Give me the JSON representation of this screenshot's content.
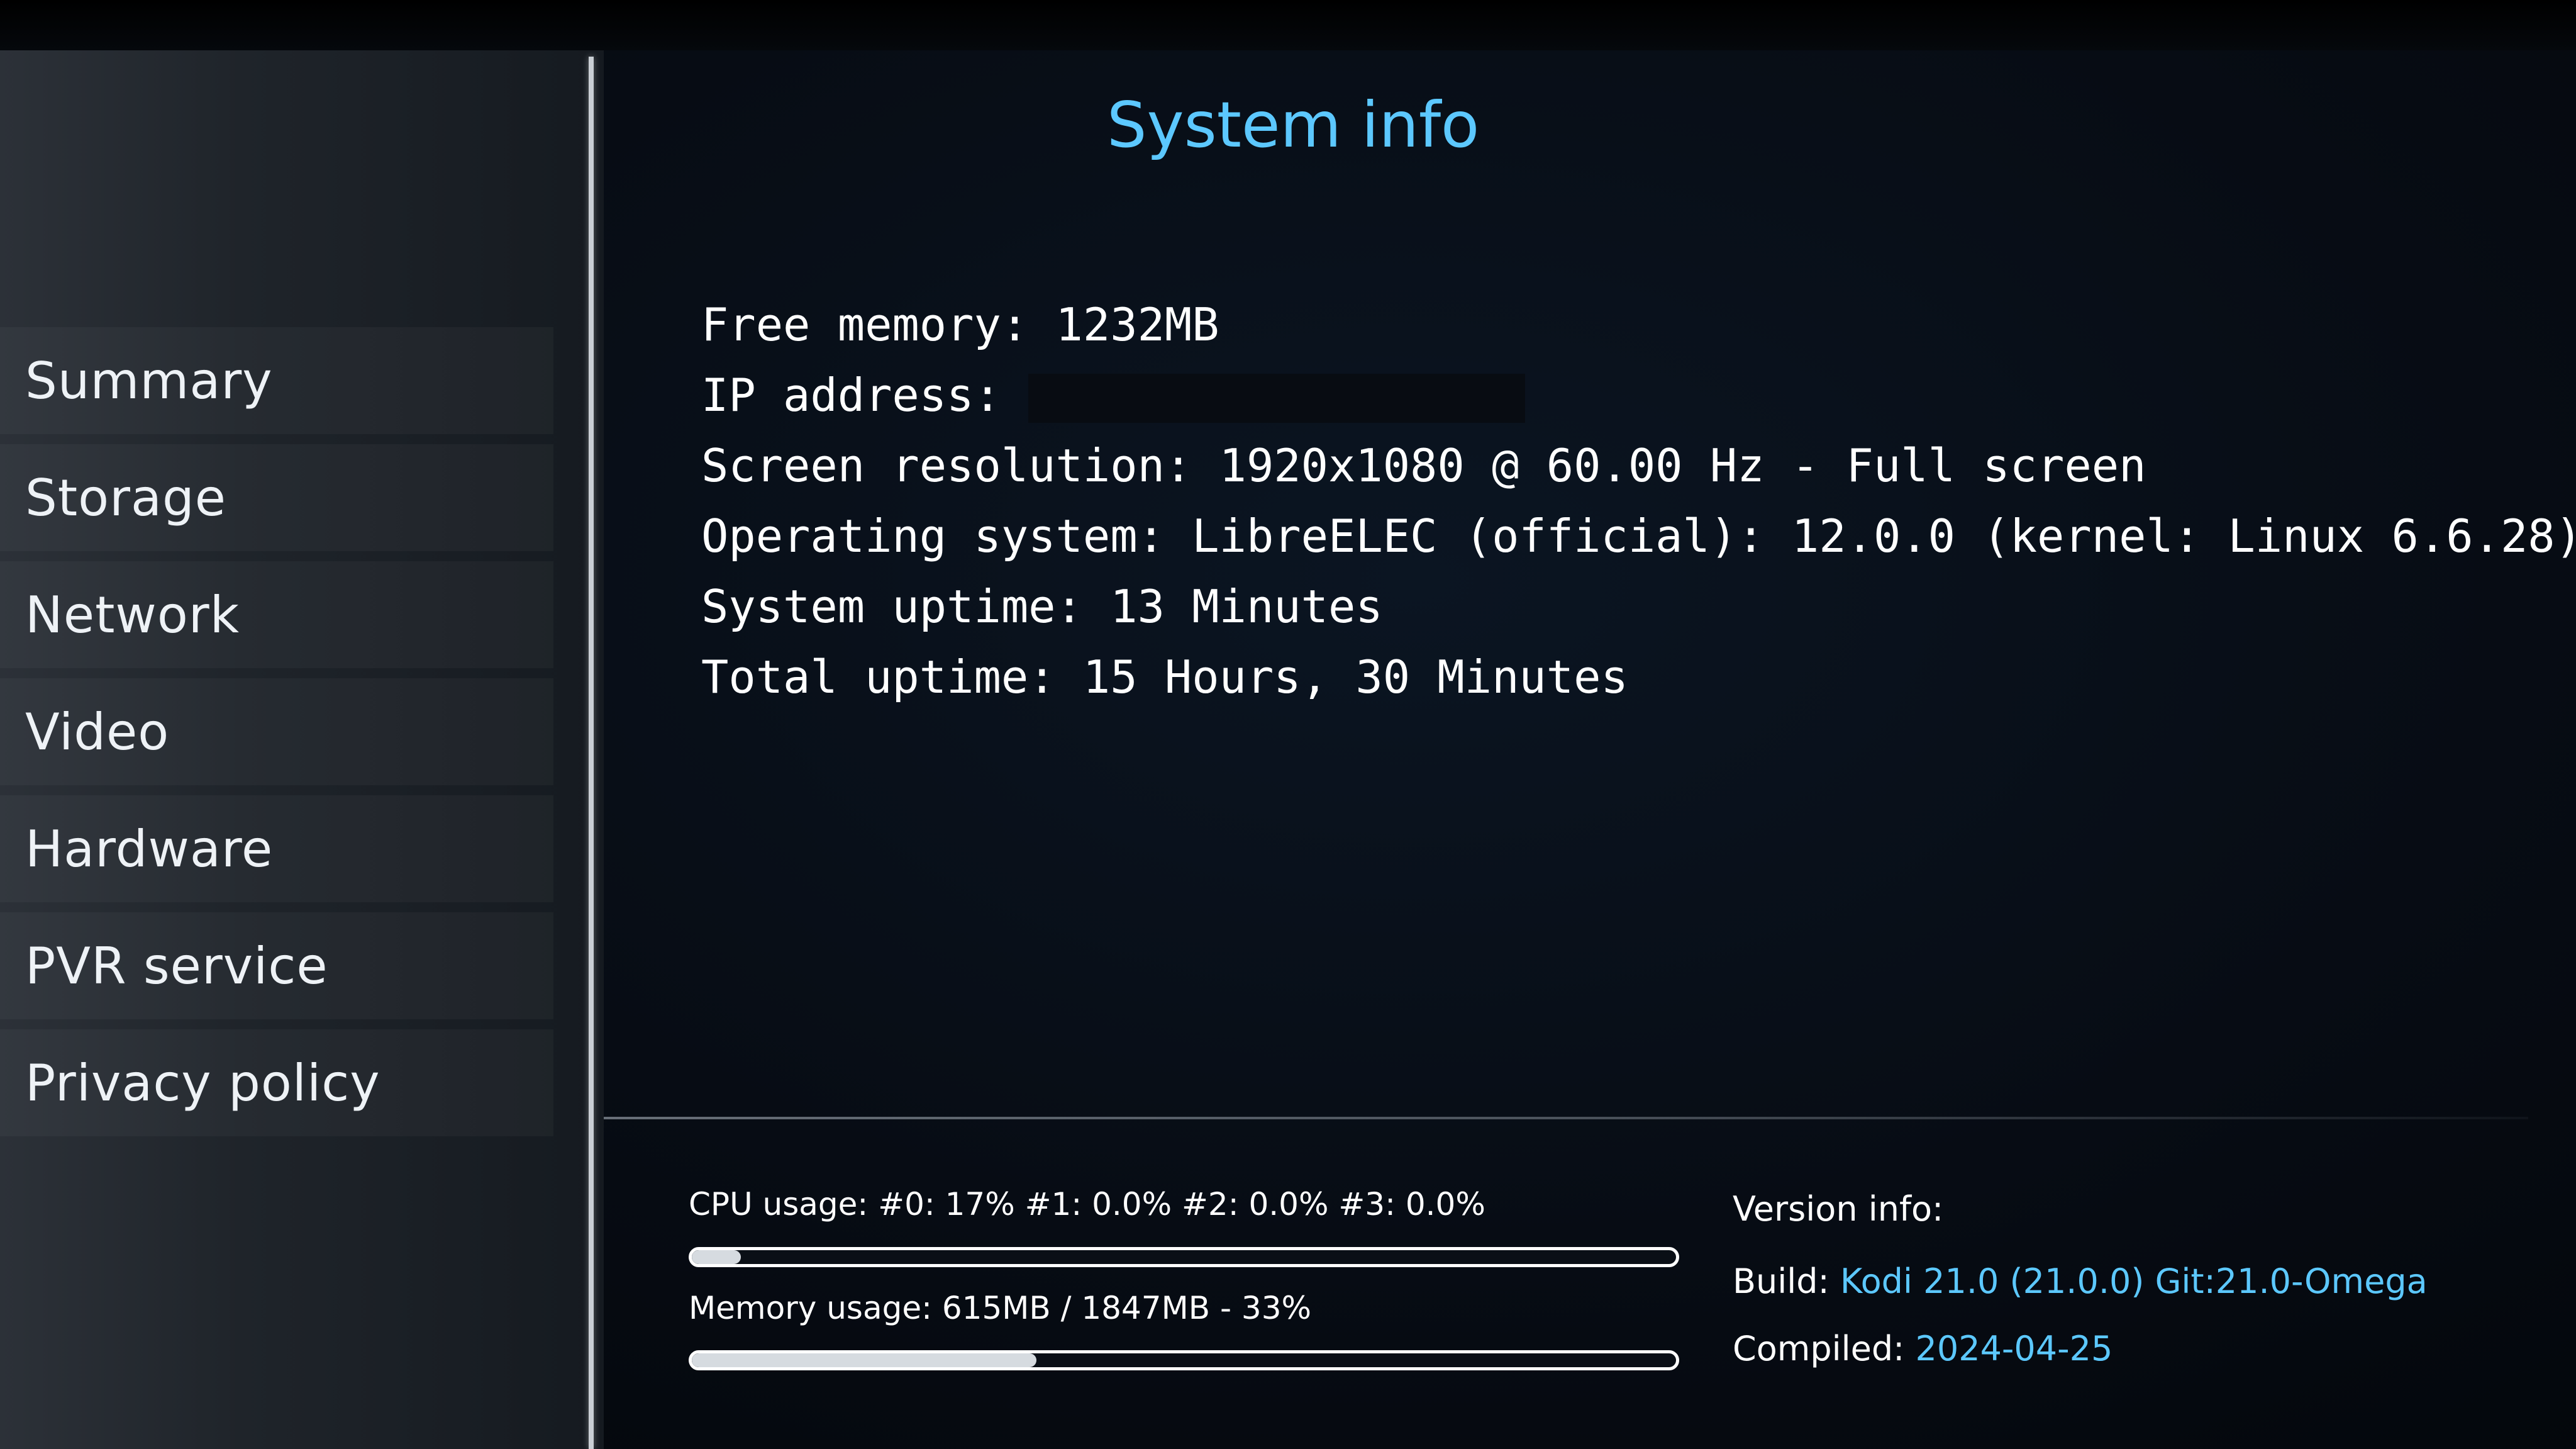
{
  "page": {
    "title": "System info"
  },
  "sidebar": {
    "items": [
      {
        "label": "Summary"
      },
      {
        "label": "Storage"
      },
      {
        "label": "Network"
      },
      {
        "label": "Video"
      },
      {
        "label": "Hardware"
      },
      {
        "label": "PVR service"
      },
      {
        "label": "Privacy policy"
      }
    ]
  },
  "info": {
    "free_memory": "Free memory: 1232MB",
    "ip_address_label": "IP address:",
    "screen_resolution": "Screen resolution: 1920x1080 @ 60.00 Hz - Full screen",
    "operating_system": "Operating system: LibreELEC (official): 12.0.0 (kernel: Linux 6.6.28)",
    "system_uptime": "System uptime: 13 Minutes",
    "total_uptime": "Total uptime: 15 Hours, 30 Minutes"
  },
  "stats": {
    "cpu_usage_label": "CPU usage: #0:  17% #1: 0.0% #2: 0.0% #3: 0.0%",
    "cpu_usage_fraction": 0.05,
    "memory_usage_label": "Memory usage: 615MB / 1847MB - 33%",
    "memory_usage_fraction": 0.35
  },
  "version": {
    "header": "Version info:",
    "build_label": "Build:",
    "build_value": "Kodi 21.0 (21.0.0) Git:21.0-Omega",
    "compiled_label": "Compiled:",
    "compiled_value": "2024-04-25"
  },
  "colors": {
    "accent": "#5cc8ff",
    "text": "#ffffff",
    "background": "#070c14"
  }
}
